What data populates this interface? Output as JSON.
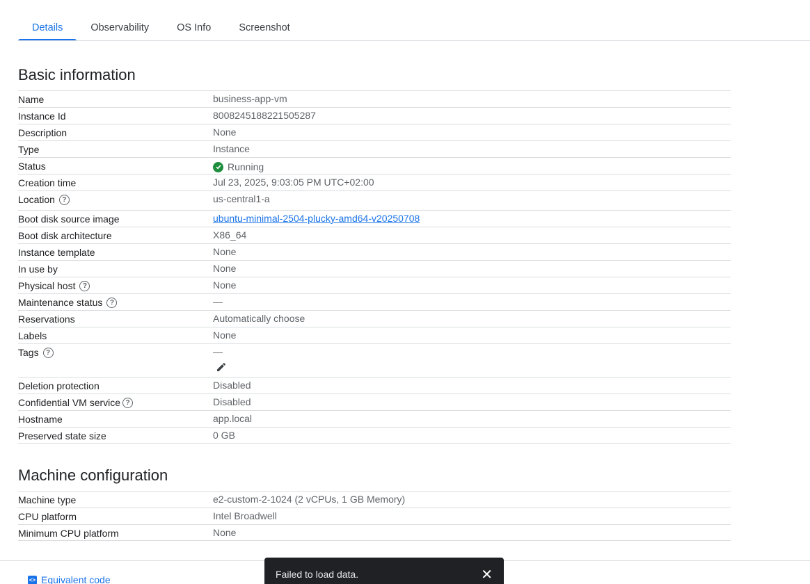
{
  "tabs": [
    {
      "label": "Details",
      "active": true
    },
    {
      "label": "Observability"
    },
    {
      "label": "OS Info"
    },
    {
      "label": "Screenshot"
    }
  ],
  "basic": {
    "title": "Basic information",
    "rows": [
      {
        "key": "Name",
        "value": "business-app-vm"
      },
      {
        "key": "Instance Id",
        "value": "8008245188221505287"
      },
      {
        "key": "Description",
        "value": "None"
      },
      {
        "key": "Type",
        "value": "Instance"
      },
      {
        "key": "Status",
        "value": "Running"
      },
      {
        "key": "Creation time",
        "value": "Jul 23, 2025, 9:03:05 PM UTC+02:00"
      },
      {
        "key": "Location",
        "value": "us-central1-a"
      },
      {
        "key": "Boot disk source image",
        "value": "ubuntu-minimal-2504-plucky-amd64-v20250708"
      },
      {
        "key": "Boot disk architecture",
        "value": "X86_64"
      },
      {
        "key": "Instance template",
        "value": "None"
      },
      {
        "key": "In use by",
        "value": "None"
      },
      {
        "key": "Physical host",
        "value": "None"
      },
      {
        "key": "Maintenance status",
        "value": "—"
      },
      {
        "key": "Reservations",
        "value": "Automatically choose"
      },
      {
        "key": "Labels",
        "value": "None"
      },
      {
        "key": "Tags",
        "value": "—"
      },
      {
        "key": "Deletion protection",
        "value": "Disabled"
      },
      {
        "key": "Confidential VM service",
        "value": "Disabled"
      },
      {
        "key": "Hostname",
        "value": "app.local"
      },
      {
        "key": "Preserved state size",
        "value": "0 GB"
      }
    ]
  },
  "machine": {
    "title": "Machine configuration",
    "rows": [
      {
        "key": "Machine type",
        "value": "e2-custom-2-1024 (2 vCPUs, 1 GB Memory)"
      },
      {
        "key": "CPU platform",
        "value": "Intel Broadwell"
      },
      {
        "key": "Minimum CPU platform",
        "value": "None"
      }
    ]
  },
  "footer": {
    "equivalent_code": "Equivalent code"
  },
  "snackbar": {
    "message": "Failed to load data."
  },
  "colors": {
    "accent": "#1a73e8",
    "status_ok": "#1e8e3e",
    "snackbar_bg": "#202124"
  },
  "icons": {
    "help": "help-circle-icon",
    "status": "check-circle-icon",
    "edit": "pencil-icon",
    "code": "code-icon",
    "close": "close-icon"
  }
}
